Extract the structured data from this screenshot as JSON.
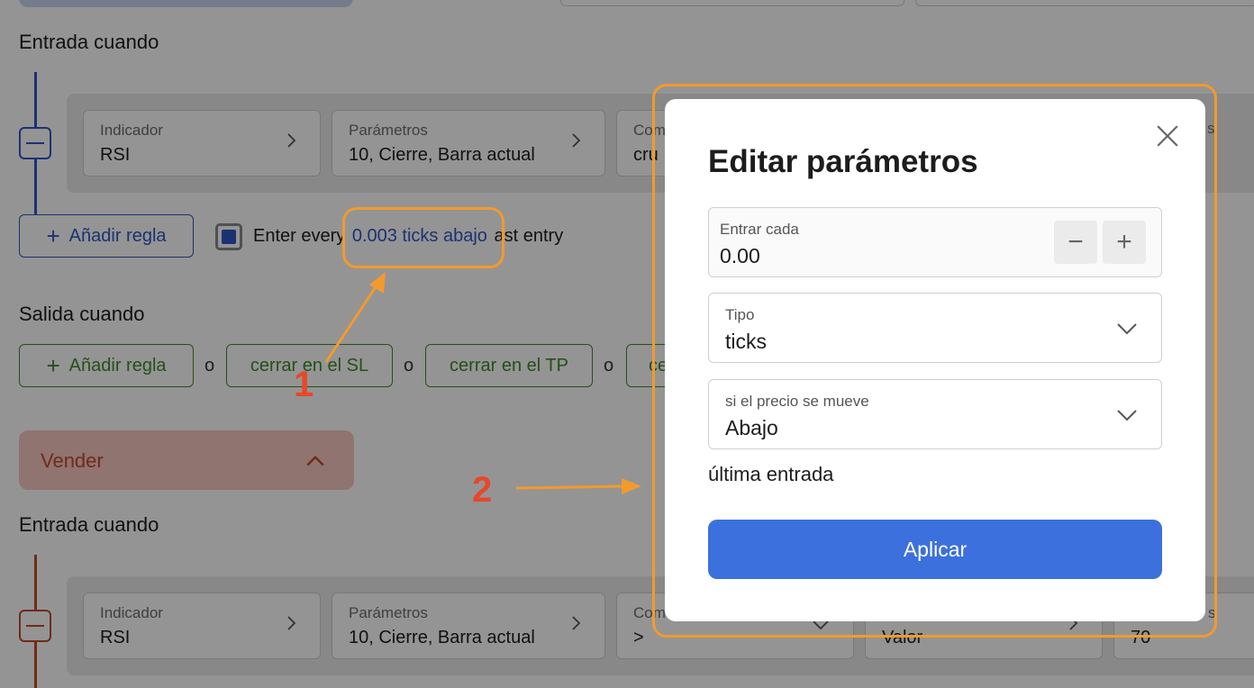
{
  "buy_section": {
    "entry_title": "Entrada cuando",
    "rule": {
      "indicator_label": "Indicador",
      "indicator_value": "RSI",
      "params_label": "Parámetros",
      "params_value": "10, Cierre, Barra actual",
      "compare_label_partial": "Com",
      "compare_value_partial": "cru"
    },
    "add_rule_label": "Añadir regla",
    "enter_every_prefix": "Enter every",
    "enter_every_link": "0.003 ticks abajo",
    "enter_every_suffix": "ast entry",
    "exit_title": "Salida cuando",
    "exit_add_rule_label": "Añadir regla",
    "or_label": "o",
    "close_sl_label": "cerrar en el SL",
    "close_tp_label": "cerrar en el TP",
    "partial_chip_label": "ce"
  },
  "sell_section": {
    "header_label": "Vender",
    "entry_title": "Entrada cuando",
    "rule": {
      "indicator_label": "Indicador",
      "indicator_value": "RSI",
      "params_label": "Parámetros",
      "params_value": "10, Cierre, Barra actual",
      "compare_label_partial": "Com",
      "compare_value": ">",
      "value_partial": "Valor",
      "number_partial": "70"
    }
  },
  "partial_right_label": "s",
  "modal": {
    "title": "Editar parámetros",
    "enter_every_label": "Entrar cada",
    "enter_every_value": "0.00",
    "decrement_symbol": "−",
    "increment_symbol": "+",
    "type_label": "Tipo",
    "type_value": "ticks",
    "direction_label": "si el precio se mueve",
    "direction_value": "Abajo",
    "last_entry_text": "última entrada",
    "apply_label": "Aplicar"
  },
  "annotations": {
    "marker_1": "1",
    "marker_2": "2",
    "color": "#f29a2e",
    "number_color": "#e8472a"
  },
  "colors": {
    "buy_accent": "#2f57c4",
    "exit_accent": "#3f8a2a",
    "sell_accent": "#c24a2c",
    "apply_button": "#3c70dc"
  }
}
